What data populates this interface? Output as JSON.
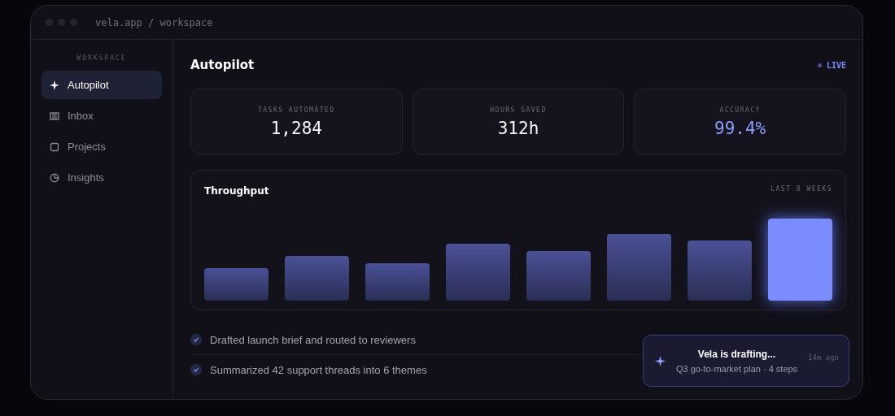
{
  "window": {
    "title": "vela.app / workspace"
  },
  "sidebar": {
    "heading": "WORKSPACE",
    "items": [
      {
        "label": "Autopilot",
        "selected": true
      },
      {
        "label": "Inbox",
        "selected": false
      },
      {
        "label": "Projects",
        "selected": false
      },
      {
        "label": "Insights",
        "selected": false
      }
    ]
  },
  "page": {
    "title": "Autopilot",
    "status": "LIVE"
  },
  "stats": [
    {
      "label": "TASKS AUTOMATED",
      "value": "1,284",
      "accent": false
    },
    {
      "label": "HOURS SAVED",
      "value": "312h",
      "accent": false
    },
    {
      "label": "ACCURACY",
      "value": "99.4%",
      "accent": true
    }
  ],
  "throughput": {
    "title": "Throughput",
    "range": "LAST 8 WEEKS"
  },
  "activity": [
    {
      "text": "Drafted launch brief and routed to reviewers",
      "checked": true
    },
    {
      "text": "Summarized 42 support threads into 6 themes",
      "checked": true
    }
  ],
  "toast": {
    "title": "Vela is drafting...",
    "subtitle": "Q3 go-to-market plan · 4 steps",
    "time": "14m ago"
  }
}
